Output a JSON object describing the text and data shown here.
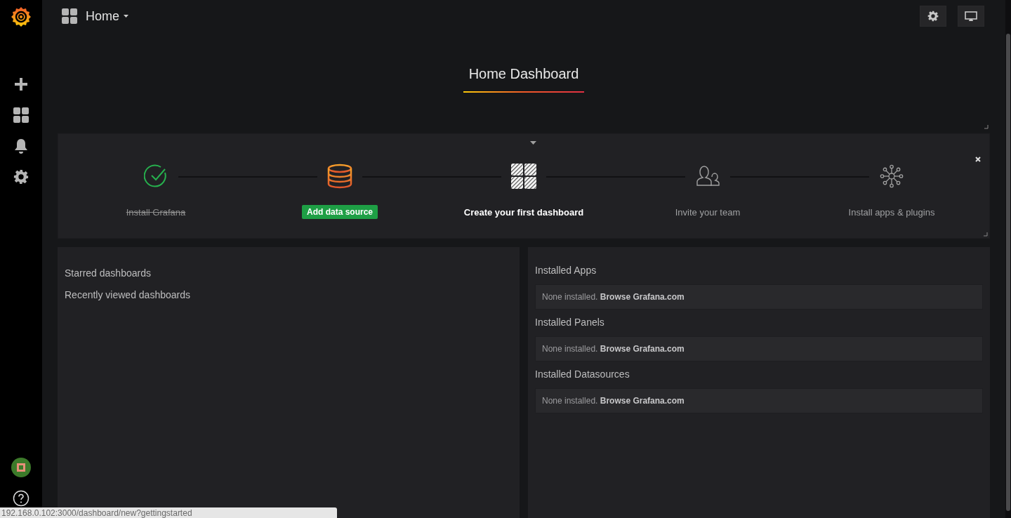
{
  "topbar": {
    "title": "Home"
  },
  "dashboard_title": "Home Dashboard",
  "steps": [
    {
      "label": "Install Grafana",
      "kind": "done"
    },
    {
      "label": "Add data source",
      "kind": "active"
    },
    {
      "label": "Create your first dashboard",
      "kind": "next"
    },
    {
      "label": "Invite your team",
      "kind": "pending"
    },
    {
      "label": "Install apps & plugins",
      "kind": "pending"
    }
  ],
  "left_panel": {
    "links": [
      "Starred dashboards",
      "Recently viewed dashboards"
    ]
  },
  "right_panel": {
    "sections": [
      {
        "heading": "Installed Apps",
        "message": "None installed.",
        "link": "Browse Grafana.com"
      },
      {
        "heading": "Installed Panels",
        "message": "None installed.",
        "link": "Browse Grafana.com"
      },
      {
        "heading": "Installed Datasources",
        "message": "None installed.",
        "link": "Browse Grafana.com"
      }
    ]
  },
  "status_url": "192.168.0.102:3000/dashboard/new?gettingstarted"
}
